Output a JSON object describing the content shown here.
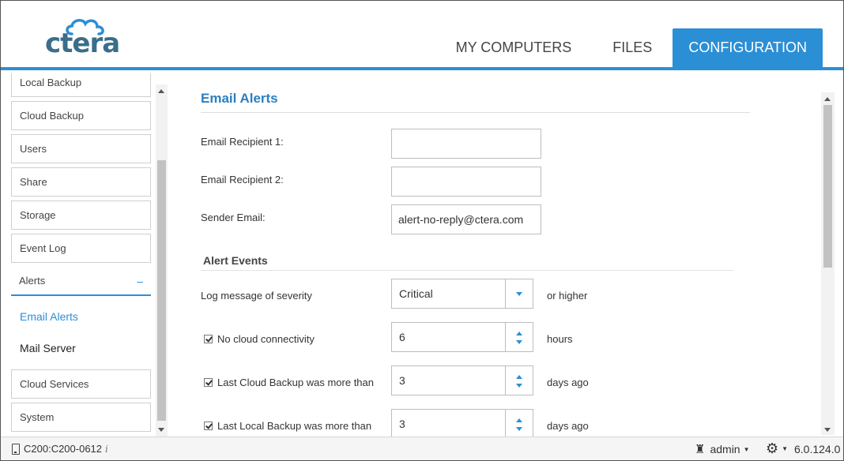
{
  "brand": {
    "logo_text": "ctera"
  },
  "nav": {
    "tabs": [
      {
        "label": "MY COMPUTERS"
      },
      {
        "label": "FILES"
      },
      {
        "label": "CONFIGURATION"
      }
    ]
  },
  "sidebar": {
    "items": [
      {
        "label": "Local Backup"
      },
      {
        "label": "Cloud Backup"
      },
      {
        "label": "Users"
      },
      {
        "label": "Share"
      },
      {
        "label": "Storage"
      },
      {
        "label": "Event Log"
      },
      {
        "label": "Alerts",
        "toggle": "–"
      }
    ],
    "sub_items": [
      {
        "label": "Email Alerts"
      },
      {
        "label": "Mail Server"
      }
    ],
    "items_after": [
      {
        "label": "Cloud Services"
      },
      {
        "label": "System"
      }
    ]
  },
  "main": {
    "title": "Email Alerts",
    "fields": {
      "recipient1_label": "Email Recipient 1:",
      "recipient1_value": "",
      "recipient2_label": "Email Recipient 2:",
      "recipient2_value": "",
      "sender_label": "Sender Email:",
      "sender_value": "alert-no-reply@ctera.com"
    },
    "alert_events": {
      "title": "Alert Events",
      "severity_label": "Log message of severity",
      "severity_value": "Critical",
      "severity_suffix": "or higher",
      "no_cloud_label": "No cloud connectivity",
      "no_cloud_value": "6",
      "no_cloud_suffix": "hours",
      "last_cloud_label": "Last Cloud Backup was more than",
      "last_cloud_value": "3",
      "last_cloud_suffix": "days ago",
      "last_local_label": "Last Local Backup was more than",
      "last_local_value": "3",
      "last_local_suffix": "days ago"
    }
  },
  "footer": {
    "device": "C200:C200-0612",
    "info": "i",
    "user": "admin",
    "version": "6.0.124.0"
  },
  "colors": {
    "accent": "#2b8fd6",
    "logo": "#3a6e8a"
  }
}
